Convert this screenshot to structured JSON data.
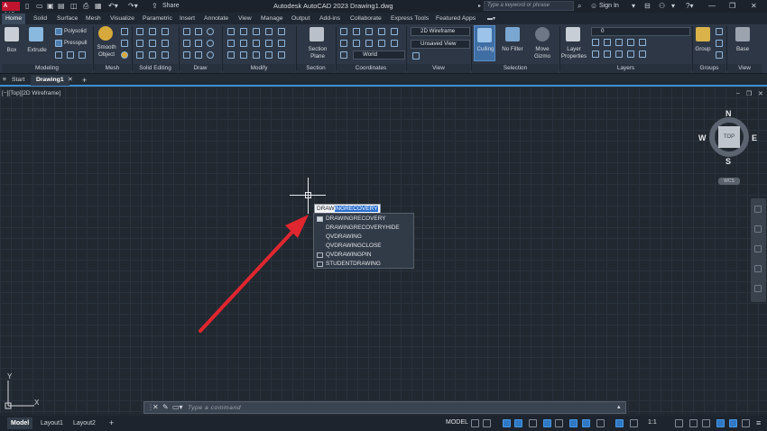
{
  "app": {
    "logo_text": "A CAD",
    "title": "Autodesk AutoCAD 2023    Drawing1.dwg",
    "share_label": "Share",
    "search_placeholder": "Type a keyword or phrase",
    "sign_in": "Sign In"
  },
  "ribbon_tabs": [
    "Home",
    "Solid",
    "Surface",
    "Mesh",
    "Visualize",
    "Parametric",
    "Insert",
    "Annotate",
    "View",
    "Manage",
    "Output",
    "Add-ins",
    "Collaborate",
    "Express Tools",
    "Featured Apps"
  ],
  "ribbon": {
    "box": "Box",
    "extrude": "Extrude",
    "polysolid": "Polysolid",
    "presspull": "Presspull",
    "smooth_object": "Smooth Object",
    "section_plane": "Section Plane",
    "visual_style": "2D Wireframe",
    "saved_view": "Unsaved View",
    "coord_world": "World",
    "culling": "Culling",
    "no_filter": "No Filter",
    "move_gizmo": "Move Gizmo",
    "layer_properties": "Layer Properties",
    "layer_current": "0",
    "group": "Group",
    "base": "Base",
    "panels": [
      "Modeling",
      "Mesh",
      "Solid Editing",
      "Draw",
      "Modify",
      "Section",
      "Coordinates",
      "View",
      "Selection",
      "Layers",
      "Groups",
      "View"
    ]
  },
  "doc_tabs": {
    "start": "Start",
    "drawing": "Drawing1"
  },
  "viewport": {
    "label": "[−][Top][2D Wireframe]",
    "cube_top": "TOP",
    "north": "N",
    "south": "S",
    "east": "E",
    "west": "W",
    "wcs": "WCS"
  },
  "dynamic_input": {
    "typed": "DRAW",
    "suggested": "INGRECOVERY"
  },
  "autocomplete": [
    "DRAWINGRECOVERY",
    "DRAWINGRECOVERYHIDE",
    "QVDRAWING",
    "QVDRAWINGCLOSE",
    "QVDRAWINGPIN",
    "STUDENTDRAWING"
  ],
  "ucs": {
    "y": "Y",
    "x": "X"
  },
  "command_line": {
    "placeholder": "Type a command"
  },
  "status_bar": {
    "layouts": [
      "Model",
      "Layout1",
      "Layout2"
    ],
    "model_label": "MODEL",
    "scale": "1:1"
  },
  "colors": {
    "accent": "#3b8fd6",
    "arrow": "#e0262f",
    "background": "#212830"
  }
}
